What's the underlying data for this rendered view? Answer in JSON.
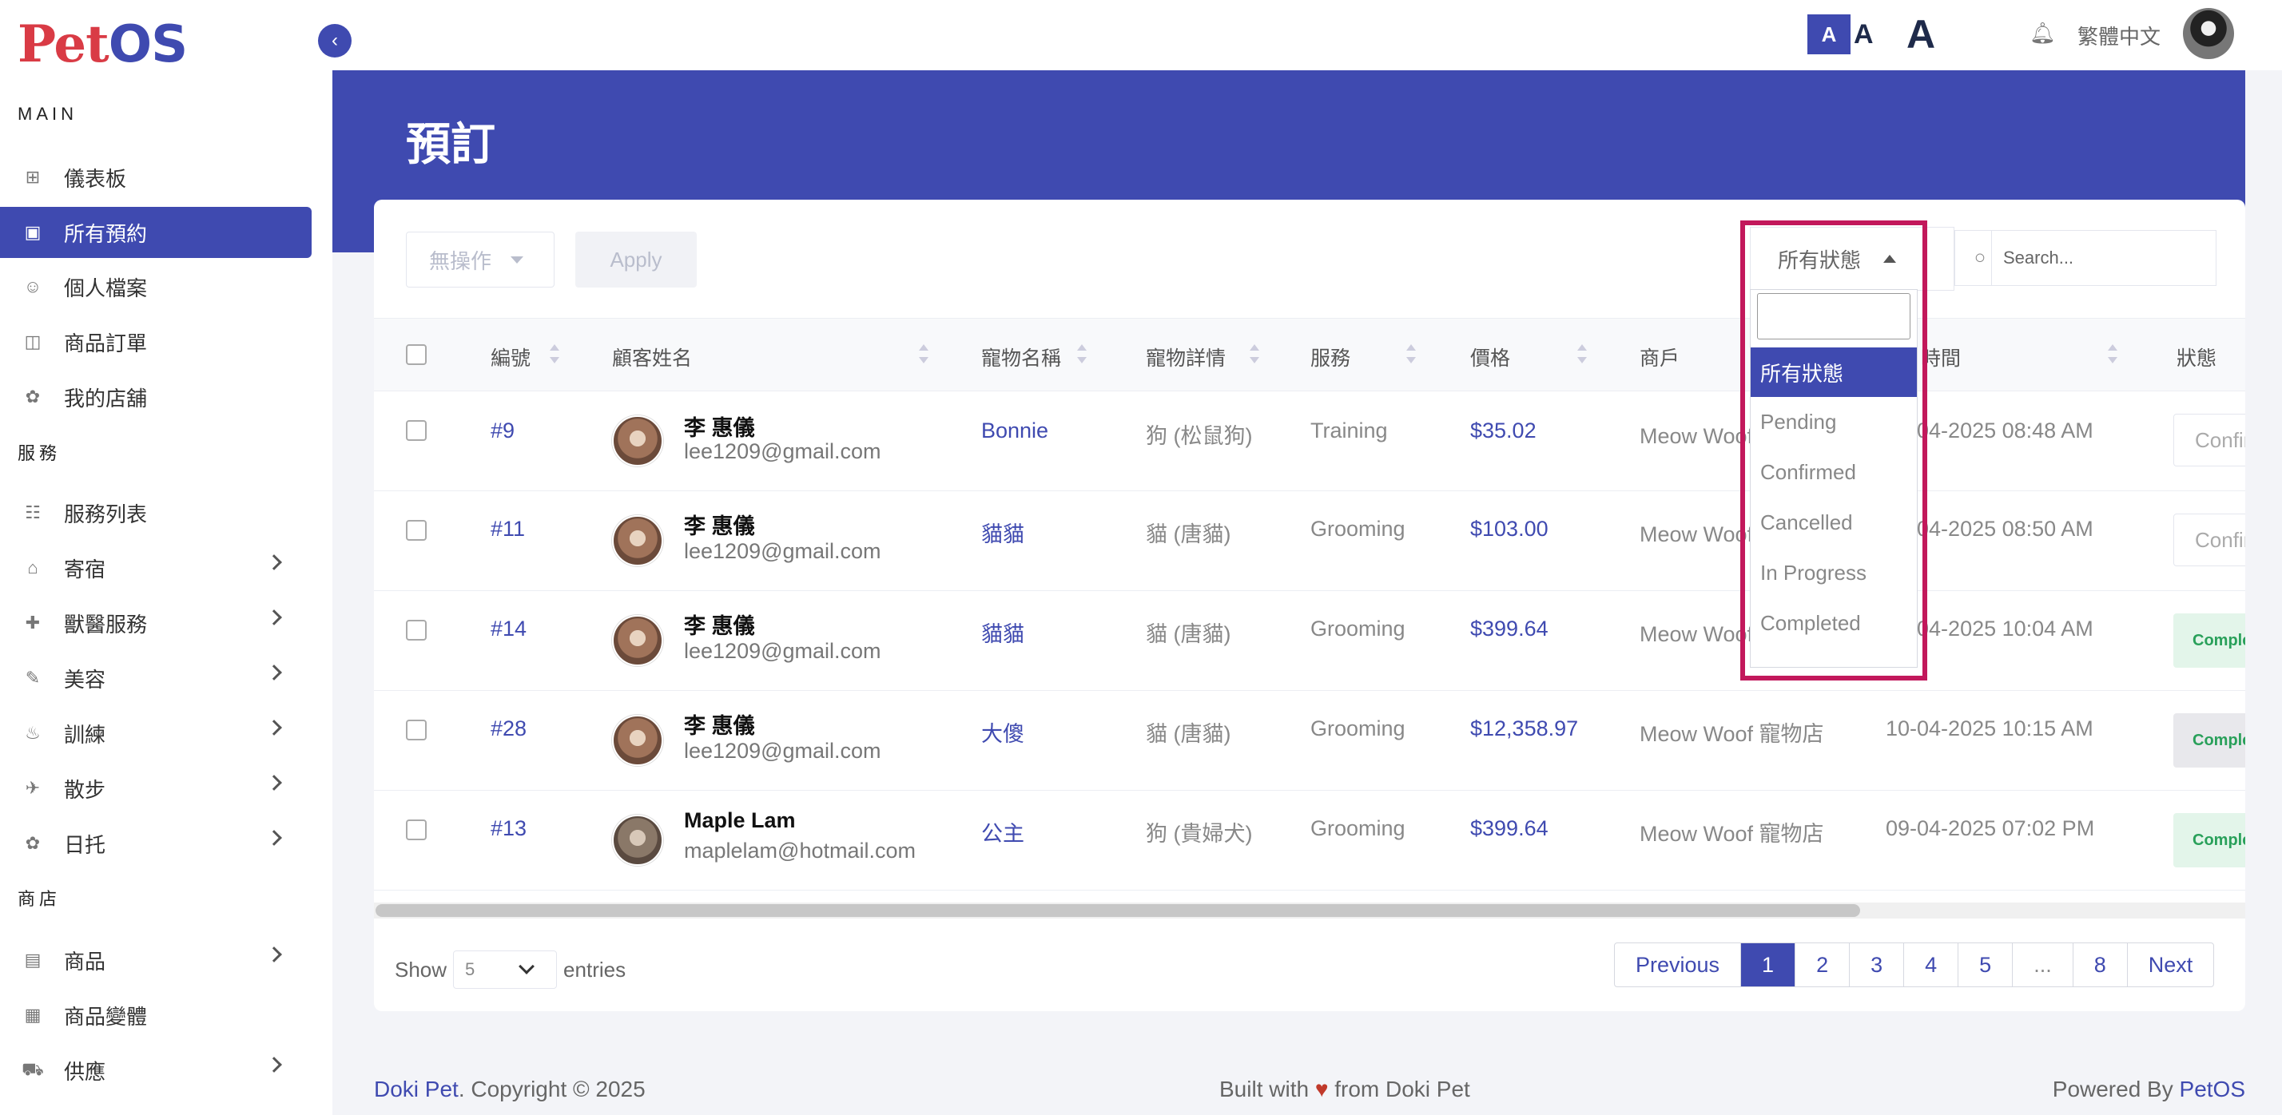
{
  "app": {
    "logo_left": "Pet",
    "logo_right": "OS"
  },
  "sidebar": {
    "section_main": "MAIN",
    "section_services": "服務",
    "section_shop": "商店",
    "main_items": [
      {
        "label": "儀表板",
        "icon": "dashboard-icon"
      },
      {
        "label": "所有預約",
        "icon": "calendar-icon",
        "active": true
      },
      {
        "label": "個人檔案",
        "icon": "user-icon"
      },
      {
        "label": "商品訂單",
        "icon": "shopping-bag-icon"
      },
      {
        "label": "我的店舖",
        "icon": "store-icon"
      }
    ],
    "service_items": [
      {
        "label": "服務列表",
        "icon": "list-icon"
      },
      {
        "label": "寄宿",
        "icon": "home-icon"
      },
      {
        "label": "獸醫服務",
        "icon": "vet-icon"
      },
      {
        "label": "美容",
        "icon": "brush-icon"
      },
      {
        "label": "訓練",
        "icon": "training-icon"
      },
      {
        "label": "散步",
        "icon": "walk-icon"
      },
      {
        "label": "日托",
        "icon": "daycare-icon"
      }
    ],
    "shop_items": [
      {
        "label": "商品",
        "icon": "product-icon"
      },
      {
        "label": "商品變體",
        "icon": "variant-icon"
      },
      {
        "label": "供應",
        "icon": "truck-icon"
      }
    ]
  },
  "topbar": {
    "font_small": "A",
    "font_medium": "A",
    "font_large": "A",
    "language": "繁體中文"
  },
  "page": {
    "title": "預訂"
  },
  "toolbar": {
    "bulk_action": "無操作",
    "apply_label": "Apply",
    "status_filter": "所有狀態",
    "search_placeholder": "Search..."
  },
  "status_dropdown": {
    "options": [
      "所有狀態",
      "Pending",
      "Confirmed",
      "Cancelled",
      "In Progress",
      "Completed"
    ],
    "selected": "所有狀態"
  },
  "table": {
    "headers": [
      "編號",
      "顧客姓名",
      "寵物名稱",
      "寵物詳情",
      "服務",
      "價格",
      "商戶",
      "時間",
      "狀態"
    ],
    "rows": [
      {
        "id": "#9",
        "name": "李 惠儀",
        "email": "lee1209@gmail.com",
        "pet": "Bonnie",
        "detail": "狗 (松鼠狗)",
        "service": "Training",
        "price": "$35.02",
        "merchant": "Meow Woof 寵物店",
        "time": "10-04-2025 08:48 AM",
        "status": "Confirmed"
      },
      {
        "id": "#11",
        "name": "李 惠儀",
        "email": "lee1209@gmail.com",
        "pet": "貓貓",
        "detail": "貓 (唐貓)",
        "service": "Grooming",
        "price": "$103.00",
        "merchant": "Meow Woof 寵物店",
        "time": "10-04-2025 08:50 AM",
        "status": "Confirmed"
      },
      {
        "id": "#14",
        "name": "李 惠儀",
        "email": "lee1209@gmail.com",
        "pet": "貓貓",
        "detail": "貓 (唐貓)",
        "service": "Grooming",
        "price": "$399.64",
        "merchant": "Meow Woof 寵物店",
        "time": "10-04-2025 10:04 AM",
        "status": "Completed"
      },
      {
        "id": "#28",
        "name": "李 惠儀",
        "email": "lee1209@gmail.com",
        "pet": "大傻",
        "detail": "貓 (唐貓)",
        "service": "Grooming",
        "price": "$12,358.97",
        "merchant": "Meow Woof 寵物店",
        "time": "10-04-2025 10:15 AM",
        "status": "Completed"
      },
      {
        "id": "#13",
        "name": "Maple Lam",
        "email": "maplelam@hotmail.com",
        "pet": "公主",
        "detail": "狗 (貴婦犬)",
        "service": "Grooming",
        "price": "$399.64",
        "merchant": "Meow Woof 寵物店",
        "time": "09-04-2025 07:02 PM",
        "status": "Completed"
      }
    ]
  },
  "table_footer": {
    "show_label": "Show",
    "page_size": "5",
    "entries_label": "entries",
    "pagination": [
      "Previous",
      "1",
      "2",
      "3",
      "4",
      "5",
      "...",
      "8",
      "Next"
    ],
    "current_page": "1"
  },
  "footer": {
    "brand": "Doki Pet",
    "copyright": ". Copyright © 2025",
    "built_prefix": "Built with",
    "heart": "♥",
    "built_suffix": "from Doki Pet",
    "powered_prefix": "Powered By",
    "powered_brand": "PetOS"
  },
  "colors": {
    "primary": "#3f4ab0",
    "highlight": "#c2185b",
    "logo_red": "#d93b45"
  }
}
